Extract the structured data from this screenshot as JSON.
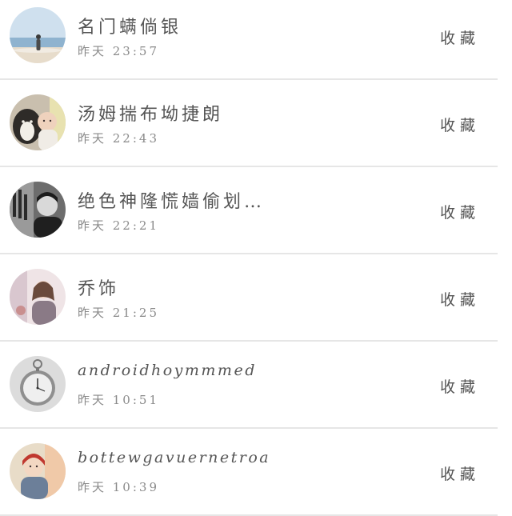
{
  "items": [
    {
      "name": "名门螨倘银",
      "time": "昨天 23:57",
      "action": "收藏",
      "avatar": "beach-person-avatar"
    },
    {
      "name": "汤姆揣布坳捷朗",
      "time": "昨天 22:43",
      "action": "收藏",
      "avatar": "dog-and-baby-avatar"
    },
    {
      "name": "绝色神隆慌嫱偷划…",
      "time": "昨天 22:21",
      "action": "收藏",
      "avatar": "bw-portrait-avatar"
    },
    {
      "name": "乔饰",
      "time": "昨天 21:25",
      "action": "收藏",
      "avatar": "girl-photo-avatar"
    },
    {
      "name": "androidhoymmmed",
      "time": "昨天 10:51",
      "action": "收藏",
      "avatar": "pocket-watch-avatar"
    },
    {
      "name": "bottewgavuernetroa",
      "time": "昨天 10:39",
      "action": "收藏",
      "avatar": "child-winter-avatar"
    }
  ]
}
